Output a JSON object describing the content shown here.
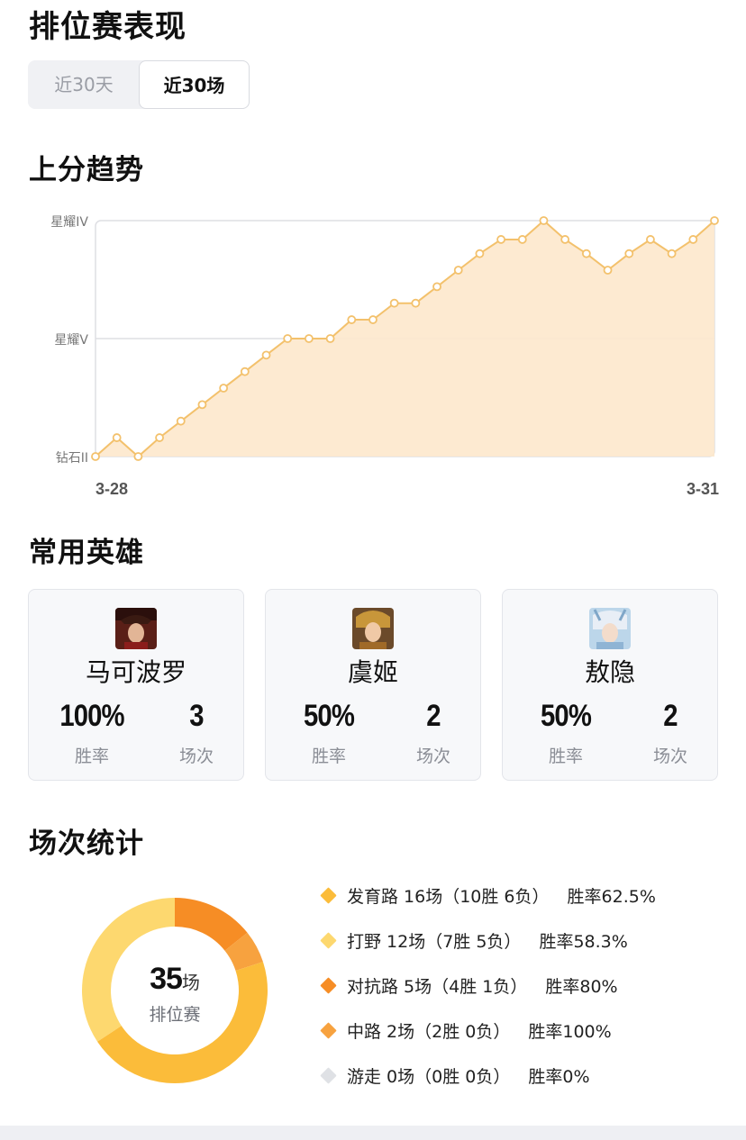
{
  "page_title": "排位赛表现",
  "tabs": [
    {
      "label": "近30天",
      "active": false
    },
    {
      "label": "近30场",
      "active": true
    }
  ],
  "trend": {
    "title": "上分趋势",
    "chart_data": {
      "type": "area",
      "y_tiers": [
        "钻石II",
        "星耀V",
        "星耀IV"
      ],
      "x_start_label": "3-28",
      "x_end_label": "3-31",
      "y_values": [
        0,
        0.08,
        0,
        0.08,
        0.15,
        0.22,
        0.29,
        0.36,
        0.43,
        0.5,
        0.5,
        0.5,
        0.58,
        0.58,
        0.65,
        0.65,
        0.72,
        0.79,
        0.86,
        0.92,
        0.92,
        1.0,
        0.92,
        0.86,
        0.79,
        0.86,
        0.92,
        0.86,
        0.92,
        1.0
      ],
      "colors": {
        "line": "#f3c16c",
        "fill": "#fde8cc",
        "point_fill": "#ffffff"
      },
      "grid": true
    }
  },
  "heroes": {
    "title": "常用英雄",
    "items": [
      {
        "name": "马可波罗",
        "win_rate": "100%",
        "win_rate_label": "胜率",
        "games": "3",
        "games_label": "场次",
        "avatar_icon": "marco-polo-avatar"
      },
      {
        "name": "虞姬",
        "win_rate": "50%",
        "win_rate_label": "胜率",
        "games": "2",
        "games_label": "场次",
        "avatar_icon": "yuji-avatar"
      },
      {
        "name": "敖隐",
        "win_rate": "50%",
        "win_rate_label": "胜率",
        "games": "2",
        "games_label": "场次",
        "avatar_icon": "aoyin-avatar"
      }
    ]
  },
  "stats": {
    "title": "场次统计",
    "total": "35",
    "total_unit": "场",
    "total_label": "排位赛",
    "chart_data": {
      "type": "pie",
      "categories": [
        "发育路",
        "打野",
        "对抗路",
        "中路",
        "游走"
      ],
      "values": [
        16,
        12,
        5,
        2,
        0
      ],
      "colors": [
        "#fbbc3a",
        "#fdd86f",
        "#f68d25",
        "#f7a23f",
        "#dfe1e5"
      ]
    },
    "legend": [
      {
        "text": "发育路 16场（10胜 6负）",
        "rate": "胜率62.5%",
        "color": "#fbbc3a"
      },
      {
        "text": "打野 12场（7胜 5负）",
        "rate": "胜率58.3%",
        "color": "#fdd86f"
      },
      {
        "text": "对抗路 5场（4胜 1负）",
        "rate": "胜率80%",
        "color": "#f68d25"
      },
      {
        "text": "中路 2场（2胜 0负）",
        "rate": "胜率100%",
        "color": "#f7a23f"
      },
      {
        "text": "游走 0场（0胜 0负）",
        "rate": "胜率0%",
        "color": "#dfe1e5"
      }
    ]
  }
}
